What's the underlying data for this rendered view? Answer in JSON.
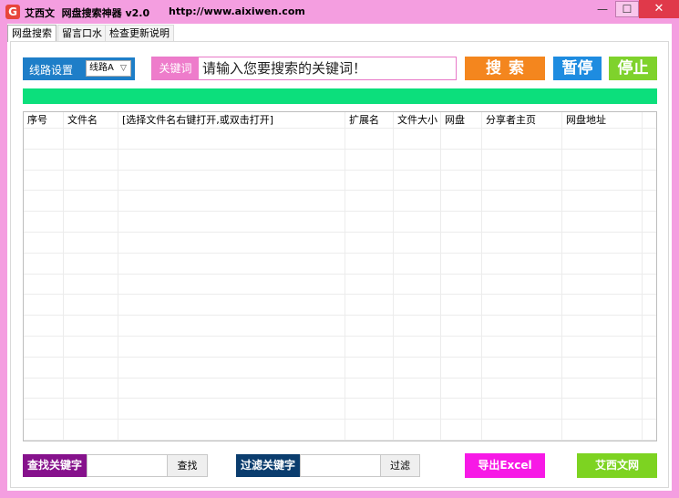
{
  "window": {
    "title": "艾西文  网盘搜索神器 v2.0",
    "url": "http://www.aixiwen.com",
    "icon_letter": "G",
    "min_symbol": "—",
    "max_symbol": "☐",
    "close_symbol": "✕"
  },
  "tabs": [
    {
      "label": "网盘搜索",
      "active": true
    },
    {
      "label": "留言口水",
      "active": false
    },
    {
      "label": "检查更新说明",
      "active": false
    }
  ],
  "search": {
    "route_label": "线路设置",
    "route_value": "线路A",
    "route_arrow": "▽",
    "keyword_label": "关键词",
    "keyword_placeholder": "请输入您要搜索的关键词！",
    "search_button": "搜索",
    "pause_button": "暂停",
    "stop_button": "停止"
  },
  "progress": {
    "fraction": 1.0
  },
  "table": {
    "columns": [
      "序号",
      "文件名",
      "[选择文件名右键打开,或双击打开]",
      "扩展名",
      "文件大小",
      "网盘",
      "分享者主页",
      "网盘地址"
    ],
    "rows": []
  },
  "footer": {
    "find_label": "查找关键字",
    "find_button": "查找",
    "filter_label": "过滤关键字",
    "filter_button": "过滤",
    "export_button": "导出Excel",
    "site_button": "艾西文网"
  },
  "colors": {
    "window_frame": "#f49ee0",
    "route_blue": "#1e7ec8",
    "keyword_pink": "#ee7ccb",
    "search_orange": "#f4861e",
    "pause_blue": "#1e8ce0",
    "stop_green": "#7fd22c",
    "progress_green": "#0cdf7c",
    "find_purple": "#86128c",
    "filter_navy": "#0b3d6e",
    "export_magenta": "#f719e6",
    "site_green": "#7dd321"
  }
}
